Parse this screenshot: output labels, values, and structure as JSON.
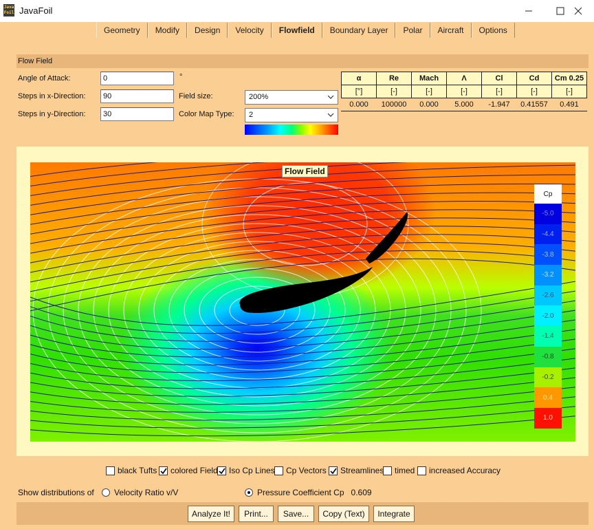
{
  "window": {
    "title": "JavaFoil",
    "icon_text": "Java Foil"
  },
  "tabs": [
    {
      "label": "Geometry"
    },
    {
      "label": "Modify"
    },
    {
      "label": "Design"
    },
    {
      "label": "Velocity"
    },
    {
      "label": "Flowfield",
      "active": true
    },
    {
      "label": "Boundary Layer"
    },
    {
      "label": "Polar"
    },
    {
      "label": "Aircraft"
    },
    {
      "label": "Options"
    }
  ],
  "panel": {
    "header": "Flow Field"
  },
  "form": {
    "angle_label": "Angle of Attack:",
    "angle_value": "0",
    "angle_unit": "°",
    "stepsx_label": "Steps in x-Direction:",
    "stepsx_value": "90",
    "stepsy_label": "Steps in y-Direction:",
    "stepsy_value": "30",
    "fieldsize_label": "Field size:",
    "fieldsize_value": "200%",
    "cmap_label": "Color Map Type:",
    "cmap_value": "2"
  },
  "results": {
    "headers": [
      "α",
      "Re",
      "Mach",
      "Λ",
      "Cl",
      "Cd",
      "Cm 0.25"
    ],
    "units": [
      "[°]",
      "[-]",
      "[-]",
      "[-]",
      "[-]",
      "[-]",
      "[-]"
    ],
    "values": [
      "0.000",
      "100000",
      "0.000",
      "5.000",
      "-1.947",
      "0.41557",
      "0.491"
    ]
  },
  "plot": {
    "title": "Flow Field",
    "legend_title": "Cp",
    "legend": [
      {
        "label": "-5.0",
        "color": "#0000e0",
        "text_color": "#8080ff"
      },
      {
        "label": "-4.4",
        "color": "#0020f0",
        "text_color": "#a0a0ff"
      },
      {
        "label": "-3.8",
        "color": "#0050ff",
        "text_color": "#a0c0ff"
      },
      {
        "label": "-3.2",
        "color": "#0090ff",
        "text_color": "#c0e0ff"
      },
      {
        "label": "-2.6",
        "color": "#00c8ff",
        "text_color": "#205080"
      },
      {
        "label": "-2.0",
        "color": "#00f0ff",
        "text_color": "#206080"
      },
      {
        "label": "-1.4",
        "color": "#00ffb0",
        "text_color": "#207050"
      },
      {
        "label": "-0.8",
        "color": "#20e040",
        "text_color": "#105010"
      },
      {
        "label": "-0.2",
        "color": "#a8f000",
        "text_color": "#405000"
      },
      {
        "label": "0.4",
        "color": "#ff9800",
        "text_color": "#ffe080"
      },
      {
        "label": "1.0",
        "color": "#ff1000",
        "text_color": "#ffd0c0"
      }
    ]
  },
  "options": {
    "black_tufts": {
      "label": "black Tufts",
      "checked": false
    },
    "colored_field": {
      "label": "colored Field",
      "checked": true
    },
    "iso_cp": {
      "label": "Iso Cp Lines",
      "checked": true
    },
    "cp_vectors": {
      "label": "Cp Vectors",
      "checked": false
    },
    "streamlines": {
      "label": "Streamlines",
      "checked": true
    },
    "timed": {
      "label": "timed",
      "checked": false
    },
    "accuracy": {
      "label": "increased Accuracy",
      "checked": false
    }
  },
  "distributions": {
    "label": "Show distributions of",
    "velocity_label": "Velocity Ratio v/V",
    "pressure_label": "Pressure Coefficient Cp",
    "pressure_value": "0.609",
    "selected": "pressure"
  },
  "buttons": {
    "analyze": "Analyze It!",
    "print": "Print...",
    "save": "Save...",
    "copy": "Copy (Text)",
    "integrate": "Integrate"
  }
}
